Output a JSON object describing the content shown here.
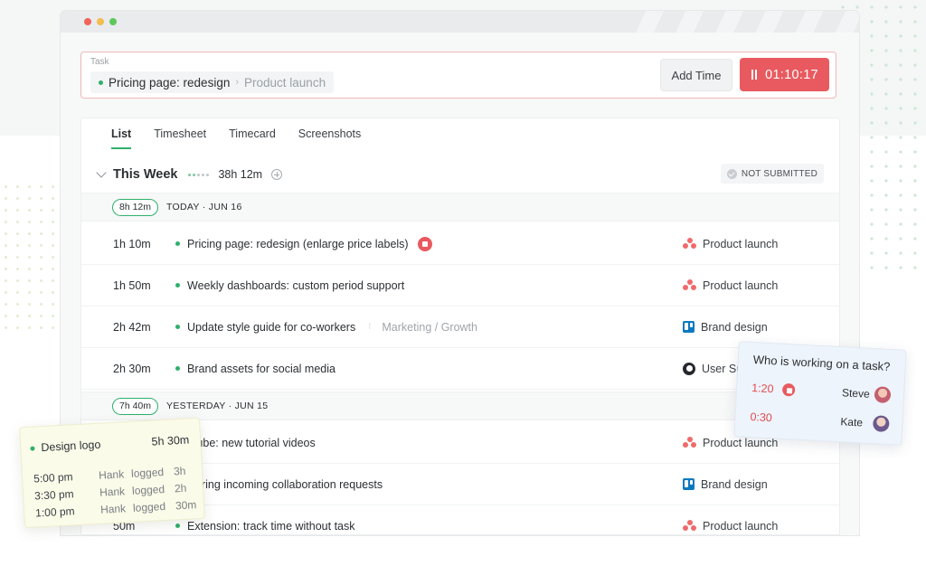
{
  "timer": {
    "label": "Task",
    "task": "Pricing page: redesign",
    "separator": "›",
    "project": "Product launch",
    "add_time": "Add Time",
    "elapsed": "01:10:17"
  },
  "tabs": [
    "List",
    "Timesheet",
    "Timecard",
    "Screenshots"
  ],
  "week": {
    "title": "This Week",
    "hours": "38h 12m",
    "status": "NOT SUBMITTED"
  },
  "days": [
    {
      "total": "8h 12m",
      "label": "TODAY · JUN 16",
      "entries": [
        {
          "duration": "1h 10m",
          "description": "Pricing page: redesign (enlarge price labels)",
          "subtitle": "",
          "project": "Product launch",
          "project_icon": "asana-icon",
          "running": true
        },
        {
          "duration": "1h 50m",
          "description": "Weekly dashboards: custom period support",
          "subtitle": "",
          "project": "Product launch",
          "project_icon": "asana-icon",
          "running": false
        },
        {
          "duration": "2h 42m",
          "description": "Update style guide for co-workers",
          "subtitle": "Marketing / Growth",
          "project": "Brand design",
          "project_icon": "trello-icon",
          "running": false
        },
        {
          "duration": "2h 30m",
          "description": "Brand assets for social media",
          "subtitle": "",
          "project": "User Su",
          "project_icon": "github-icon",
          "running": false
        }
      ]
    },
    {
      "total": "7h 40m",
      "label": "YESTERDAY · JUN 15",
      "entries": [
        {
          "duration": "",
          "description": "utube: new tutorial videos",
          "subtitle": "",
          "project": "Product launch",
          "project_icon": "asana-icon",
          "running": false
        },
        {
          "duration": "",
          "description": "wering incoming collaboration requests",
          "subtitle": "",
          "project": "Brand design",
          "project_icon": "trello-icon",
          "running": false
        },
        {
          "duration": "50m",
          "description": "Extension: track time without task",
          "subtitle": "",
          "project": "Product launch",
          "project_icon": "asana-icon",
          "running": false
        }
      ]
    }
  ],
  "who_card": {
    "title": "Who is working on a task?",
    "rows": [
      {
        "time": "1:20",
        "name": "Steve",
        "running": true
      },
      {
        "time": "0:30",
        "name": "Kate",
        "running": false
      }
    ]
  },
  "logo_card": {
    "task": "Design logo",
    "total": "5h 30m",
    "rows": [
      {
        "time": "5:00 pm",
        "user": "Hank",
        "action": "logged",
        "amount": "3h"
      },
      {
        "time": "3:30 pm",
        "user": "Hank",
        "action": "logged",
        "amount": "2h"
      },
      {
        "time": "1:00 pm",
        "user": "Hank",
        "action": "logged",
        "amount": "30m"
      }
    ]
  },
  "colors": {
    "accent_green": "#2eb06b",
    "stop_red": "#e85a5f"
  }
}
